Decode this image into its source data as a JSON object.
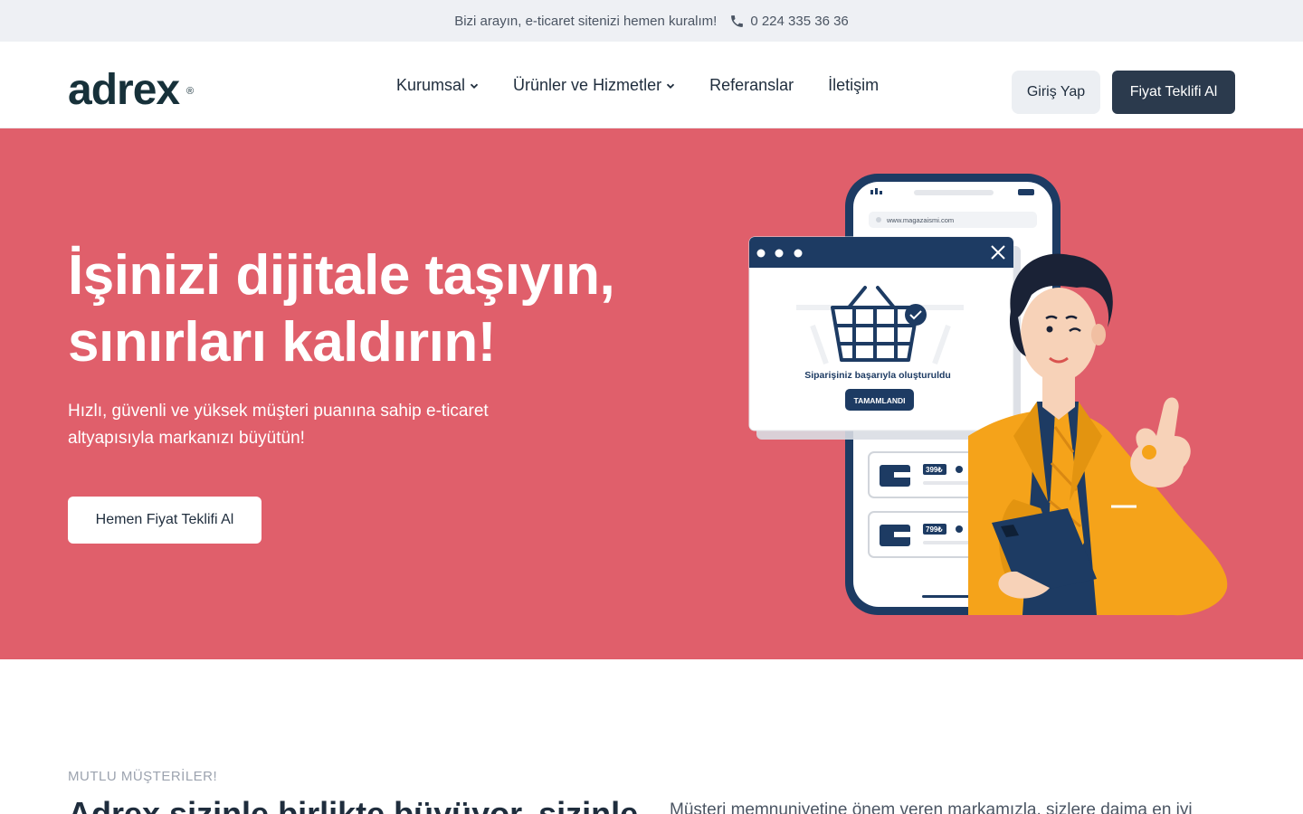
{
  "topbar": {
    "text": "Bizi arayın, e-ticaret sitenizi hemen kuralım!",
    "phone": "0 224 335 36 36",
    "phone_icon": "phone-icon"
  },
  "header": {
    "logo_text": "adrex",
    "logo_mark": "®",
    "nav": [
      {
        "label": "Kurumsal",
        "dropdown": true
      },
      {
        "label": "Ürünler ve Hizmetler",
        "dropdown": true
      },
      {
        "label": "Referanslar",
        "dropdown": false
      },
      {
        "label": "İletişim",
        "dropdown": false
      }
    ],
    "login_label": "Giriş Yap",
    "quote_label": "Fiyat Teklifi Al"
  },
  "hero": {
    "title_line1": "İşinizi dijitale taşıyın,",
    "title_line2": "sınırları kaldırın!",
    "subtitle_line1": "Hızlı, güvenli ve yüksek müşteri puanına sahip e-ticaret",
    "subtitle_line2": "altyapısıyla markanızı büyütün!",
    "cta_label": "Hemen Fiyat Teklifi Al",
    "illustration": {
      "url_text": "www.magazaismi.com",
      "order_text": "Siparişiniz başarıyla oluşturuldu",
      "done_label": "TAMAMLANDI",
      "price1": "399₺",
      "price2": "799₺"
    }
  },
  "section2": {
    "eyebrow": "MUTLU MÜŞTERİLER!",
    "title": "Adrex sizinle birlikte büyüyor, sizinle",
    "text": "Müşteri memnuniyetine önem veren markamızla, sizlere daima en iyi"
  },
  "colors": {
    "hero_bg": "#e05f6b",
    "primary_dark": "#2b3a4d",
    "navy": "#1d3b63",
    "orange": "#f5a31a",
    "topbar_bg": "#eef0f4"
  }
}
